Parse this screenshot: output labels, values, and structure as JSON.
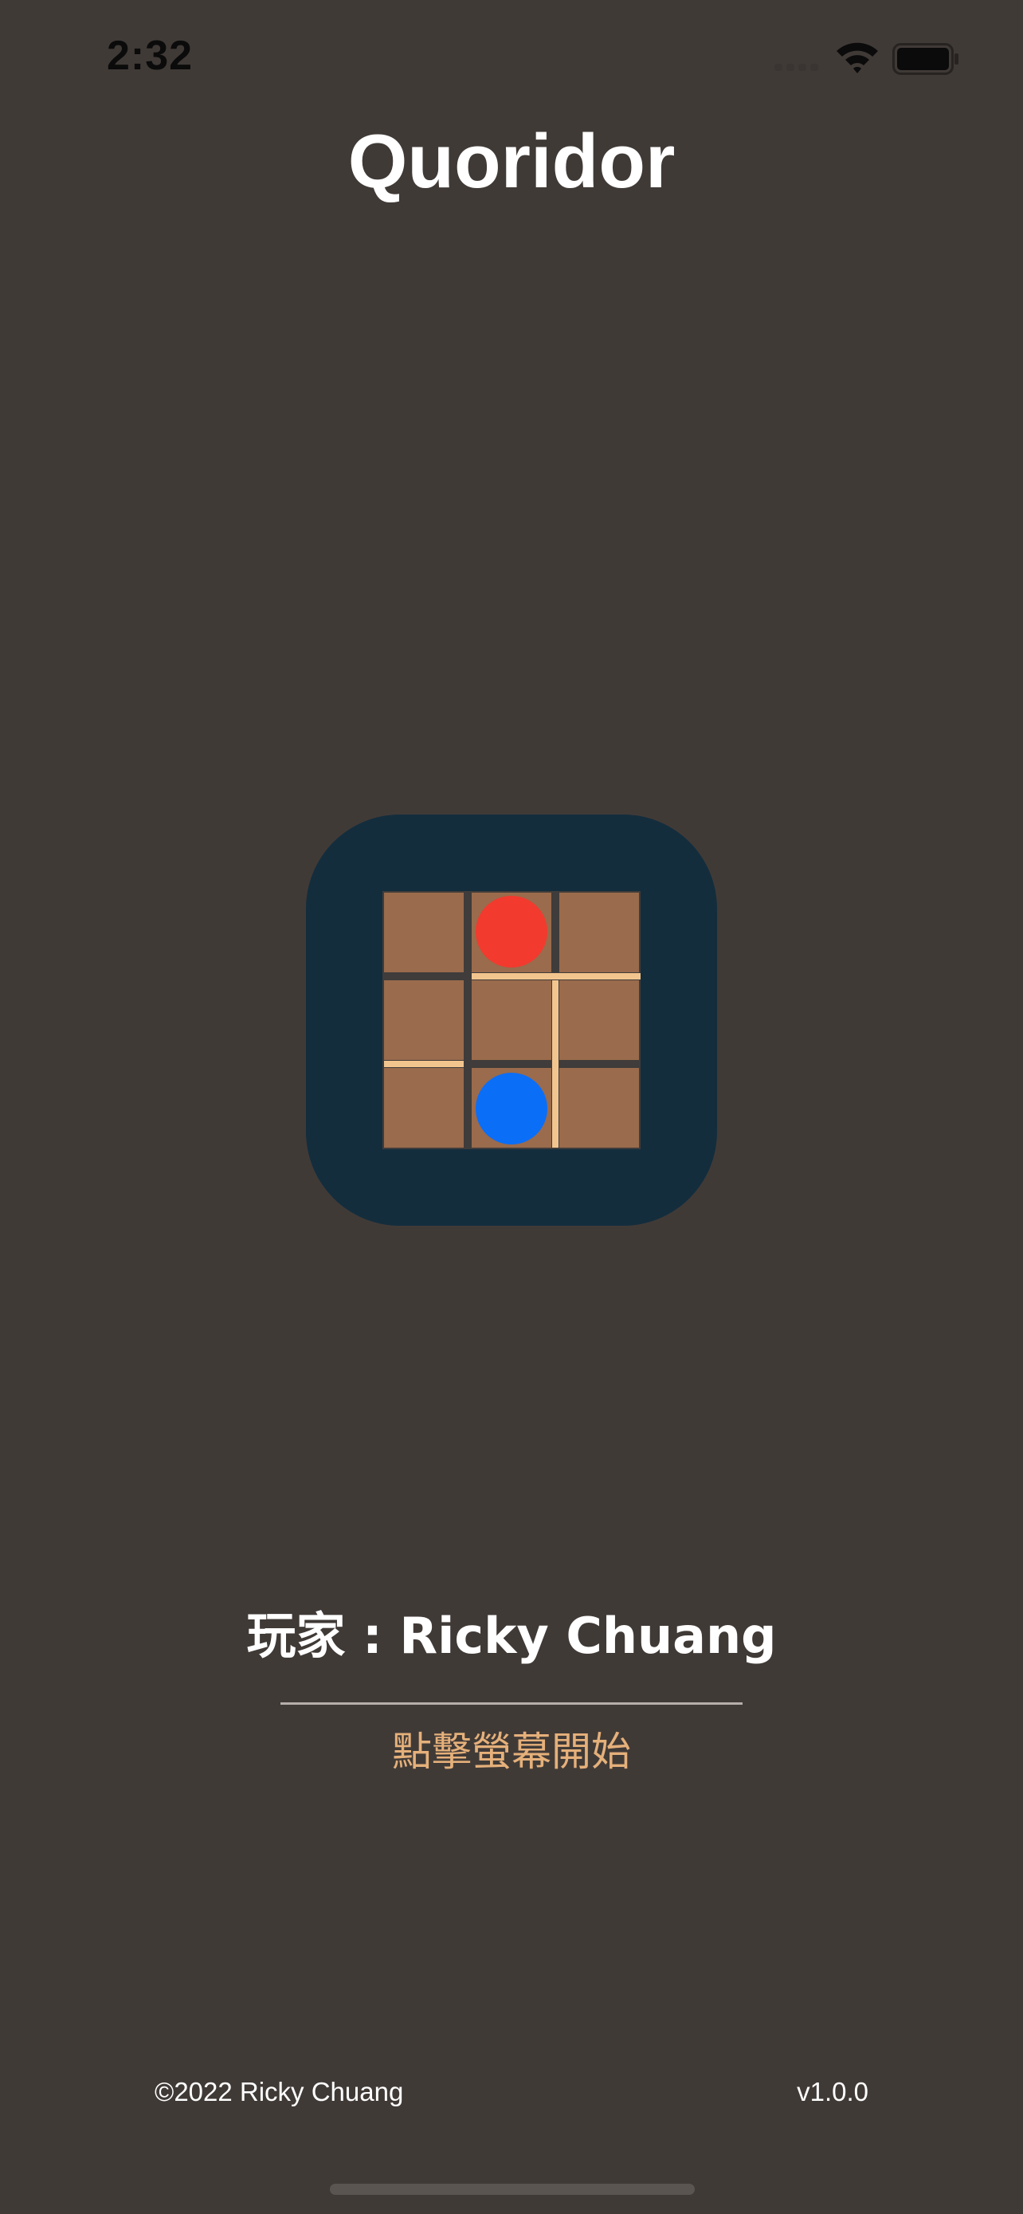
{
  "status_bar": {
    "time": "2:32",
    "icons": [
      "cellular-signal-icon",
      "wifi-icon",
      "battery-icon"
    ]
  },
  "header": {
    "title": "Quoridor"
  },
  "app_icon": {
    "name": "quoridor-board-logo-icon",
    "colors": {
      "background": "#132d3d",
      "cell": "#9a6b4c",
      "wall": "#f3c58e",
      "red_pawn": "#f23a2e",
      "blue_pawn": "#0b6ef7"
    }
  },
  "player": {
    "label": "玩家 : Ricky Chuang"
  },
  "prompt": {
    "tap_to_start": "點擊螢幕開始"
  },
  "footer": {
    "copyright": "©2022 Ricky Chuang",
    "version": "v1.0.0"
  },
  "colors": {
    "background": "#403a37",
    "accent": "#e5b07a",
    "text": "#ffffff"
  }
}
